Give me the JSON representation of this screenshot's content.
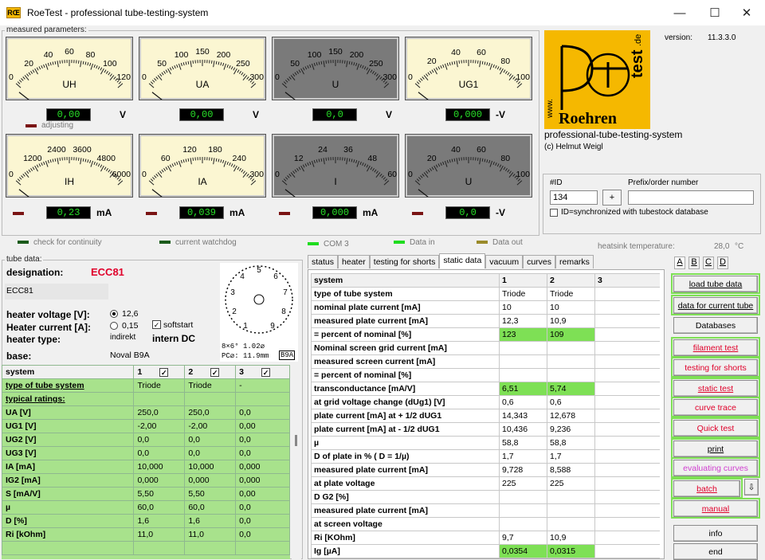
{
  "window": {
    "title": "RoeTest - professional tube-testing-system",
    "icon_text": "RŒ"
  },
  "measured_label": "measured parameters:",
  "meters_row1": [
    {
      "label": "UH",
      "scale": [
        "0",
        "20",
        "40",
        "60",
        "80",
        "100",
        "120"
      ],
      "value": "0,00",
      "unit": "V",
      "dark": false
    },
    {
      "label": "UA",
      "scale": [
        "0",
        "50",
        "100",
        "150",
        "200",
        "250",
        "300"
      ],
      "value": "0,00",
      "unit": "V",
      "dark": false
    },
    {
      "label": "U",
      "scale": [
        "0",
        "50",
        "100",
        "150",
        "200",
        "250",
        "300"
      ],
      "value": "0,0",
      "unit": "V",
      "dark": true
    },
    {
      "label": "UG1",
      "scale": [
        "0",
        "20",
        "40",
        "60",
        "80",
        "100"
      ],
      "value": "0,000",
      "unit": "-V",
      "dark": false
    }
  ],
  "meters_row2": [
    {
      "label": "IH",
      "scale": [
        "0",
        "1200",
        "2400",
        "3600",
        "4800",
        "6000"
      ],
      "value": "0,23",
      "unit": "mA",
      "dark": false
    },
    {
      "label": "IA",
      "scale": [
        "0",
        "60",
        "120",
        "180",
        "240",
        "300"
      ],
      "value": "0,039",
      "unit": "mA",
      "dark": false
    },
    {
      "label": "I",
      "scale": [
        "0",
        "12",
        "24",
        "36",
        "48",
        "60"
      ],
      "value": "0,000",
      "unit": "mA",
      "dark": true
    },
    {
      "label": "U",
      "scale": [
        "0",
        "20",
        "40",
        "60",
        "80",
        "100"
      ],
      "value": "0,0",
      "unit": "-V",
      "dark": true
    }
  ],
  "adjusting": "adjusting",
  "version_label": "version:",
  "version": "11.3.3.0",
  "logo": {
    "top": ".de",
    "side": "test",
    "www": "www.",
    "bottom": "Roehren"
  },
  "brand": "professional-tube-testing-system",
  "copyright": "(c) Helmut Weigl",
  "id_label": "#ID",
  "id_value": "134",
  "id_plus": "+",
  "prefix_label": "Prefix/order number",
  "prefix_value": "",
  "sync_label": "ID=synchronized with tubestock database",
  "status": {
    "continuity": "check for continuity",
    "watchdog": "current watchdog",
    "com": "COM 3",
    "data_in": "Data in",
    "data_out": "Data out",
    "heatsink": "heatsink temperature:",
    "temp": "28,0",
    "temp_unit": "°C"
  },
  "tube": {
    "section": "tube data:",
    "designation_label": "designation:",
    "designation": "ECC81",
    "name2": "ECC81",
    "heater_voltage_label": "heater voltage [V]:",
    "heater_current_label": "Heater current [A]:",
    "heater_type_label": "heater type:",
    "hv_value": "12,6",
    "hc_value": "0,15",
    "ht_value": "indirekt",
    "softstart": "softstart",
    "intern": "intern DC",
    "base_label": "base:",
    "base": "Noval B9A",
    "pin_caption": "8×6° 1.02⌀",
    "pc_caption": "PC⌀: 11.9mm",
    "b9a": "B9A"
  },
  "left_table": {
    "header": [
      "system",
      "1",
      "2",
      "3"
    ],
    "rows": [
      [
        "type of tube system",
        "Triode",
        "Triode",
        "-"
      ],
      [
        "typical ratings:",
        "",
        "",
        ""
      ],
      [
        "UA [V]",
        "250,0",
        "250,0",
        "0,0"
      ],
      [
        "UG1 [V]",
        "-2,00",
        "-2,00",
        "0,00"
      ],
      [
        "UG2 [V]",
        "0,0",
        "0,0",
        "0,0"
      ],
      [
        "UG3 [V]",
        "0,0",
        "0,0",
        "0,0"
      ],
      [
        "IA [mA]",
        "10,000",
        "10,000",
        "0,000"
      ],
      [
        "IG2 [mA]",
        "0,000",
        "0,000",
        "0,000"
      ],
      [
        "S [mA/V]",
        "5,50",
        "5,50",
        "0,00"
      ],
      [
        "µ",
        "60,0",
        "60,0",
        "0,0"
      ],
      [
        "D [%]",
        "1,6",
        "1,6",
        "0,0"
      ],
      [
        "Ri [kOhm]",
        "11,0",
        "11,0",
        "0,0"
      ],
      [
        "",
        "",
        "",
        ""
      ]
    ]
  },
  "tabs": [
    "status",
    "heater",
    "testing for shorts",
    "static data",
    "vacuum",
    "curves",
    "remarks"
  ],
  "right_tabs": [
    "A",
    "B",
    "C",
    "D"
  ],
  "static_table": {
    "header": [
      "system",
      "1",
      "2",
      "3"
    ],
    "rows": [
      [
        "type of tube system",
        "Triode",
        "Triode",
        ""
      ],
      [
        "nominal plate current [mA]",
        "10",
        "10",
        ""
      ],
      [
        "measured plate current [mA]",
        "12,3",
        "10,9",
        ""
      ],
      [
        "= percent of nominal [%]",
        "123",
        "109",
        ""
      ],
      [
        "Nominal screen grid current [mA]",
        "",
        "",
        ""
      ],
      [
        "measured screen current [mA]",
        "",
        "",
        ""
      ],
      [
        "= percent of nominal [%]",
        "",
        "",
        ""
      ],
      [
        "transconductance [mA/V]",
        "6,51",
        "5,74",
        ""
      ],
      [
        "at grid voltage change (dUg1) [V]",
        "0,6",
        "0,6",
        ""
      ],
      [
        "plate current [mA] at + 1/2 dUG1",
        "14,343",
        "12,678",
        ""
      ],
      [
        "plate current [mA] at - 1/2 dUG1",
        "10,436",
        "9,236",
        ""
      ],
      [
        "µ",
        "58,8",
        "58,8",
        ""
      ],
      [
        "D of plate in % ( D = 1/µ)",
        "1,7",
        "1,7",
        ""
      ],
      [
        "measured plate current [mA]",
        "9,728",
        "8,588",
        ""
      ],
      [
        "at plate voltage",
        "225",
        "225",
        ""
      ],
      [
        "D G2 [%]",
        "",
        "",
        ""
      ],
      [
        "measured plate current [mA]",
        "",
        "",
        ""
      ],
      [
        "at screen voltage",
        "",
        "",
        ""
      ],
      [
        "Ri [KOhm]",
        "9,7",
        "10,9",
        ""
      ],
      [
        "Ig [µA]",
        "0,0354",
        "0,0315",
        ""
      ]
    ],
    "green_cells": [
      [
        3,
        1
      ],
      [
        3,
        2
      ],
      [
        7,
        1
      ],
      [
        7,
        2
      ],
      [
        19,
        1
      ],
      [
        19,
        2
      ]
    ]
  },
  "buttons": {
    "load": "load tube data",
    "data_current": "data for current tube",
    "databases": "Databases",
    "filament": "filament test",
    "shorts": "testing for shorts",
    "static": "static test",
    "curve": "curve trace",
    "quick": "Quick test",
    "print": "print",
    "evaluating": "evaluating curves",
    "batch": "batch",
    "batch_arrow": "⇩",
    "manual": "manual",
    "info": "info",
    "end": "end"
  }
}
